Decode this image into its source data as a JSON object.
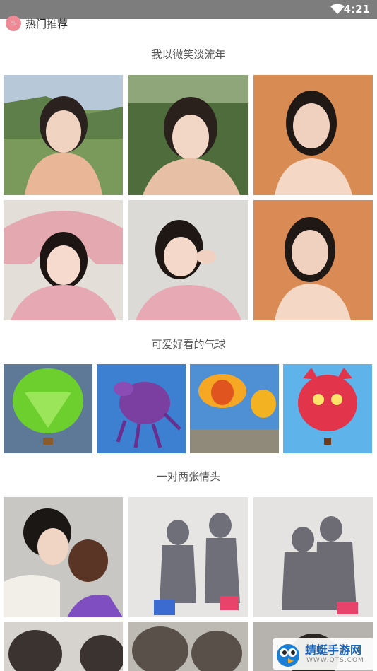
{
  "status_bar": {
    "time": "4:21"
  },
  "header": {
    "title": "热门推荐",
    "logo_icon": "app-logo-icon"
  },
  "sections": [
    {
      "title": "我以微笑淡流年",
      "tiles": [
        "portrait-photo",
        "portrait-photo",
        "portrait-photo",
        "portrait-photo",
        "portrait-photo",
        "portrait-photo"
      ]
    },
    {
      "title": "可爱好看的气球",
      "tiles": [
        "balloon-photo",
        "balloon-photo",
        "balloon-photo",
        "balloon-photo"
      ]
    },
    {
      "title": "一对两张情头",
      "tiles": [
        "couple-photo",
        "couple-photo",
        "couple-photo",
        "couple-photo",
        "couple-photo",
        "couple-photo"
      ]
    }
  ],
  "watermark": {
    "name": "蜻蜓手游网",
    "url": "WWW.QTS.COM"
  },
  "colors": {
    "status_bar": "#7d7d7d",
    "logo": "#ee8a96",
    "watermark_text": "#1a63b8"
  }
}
